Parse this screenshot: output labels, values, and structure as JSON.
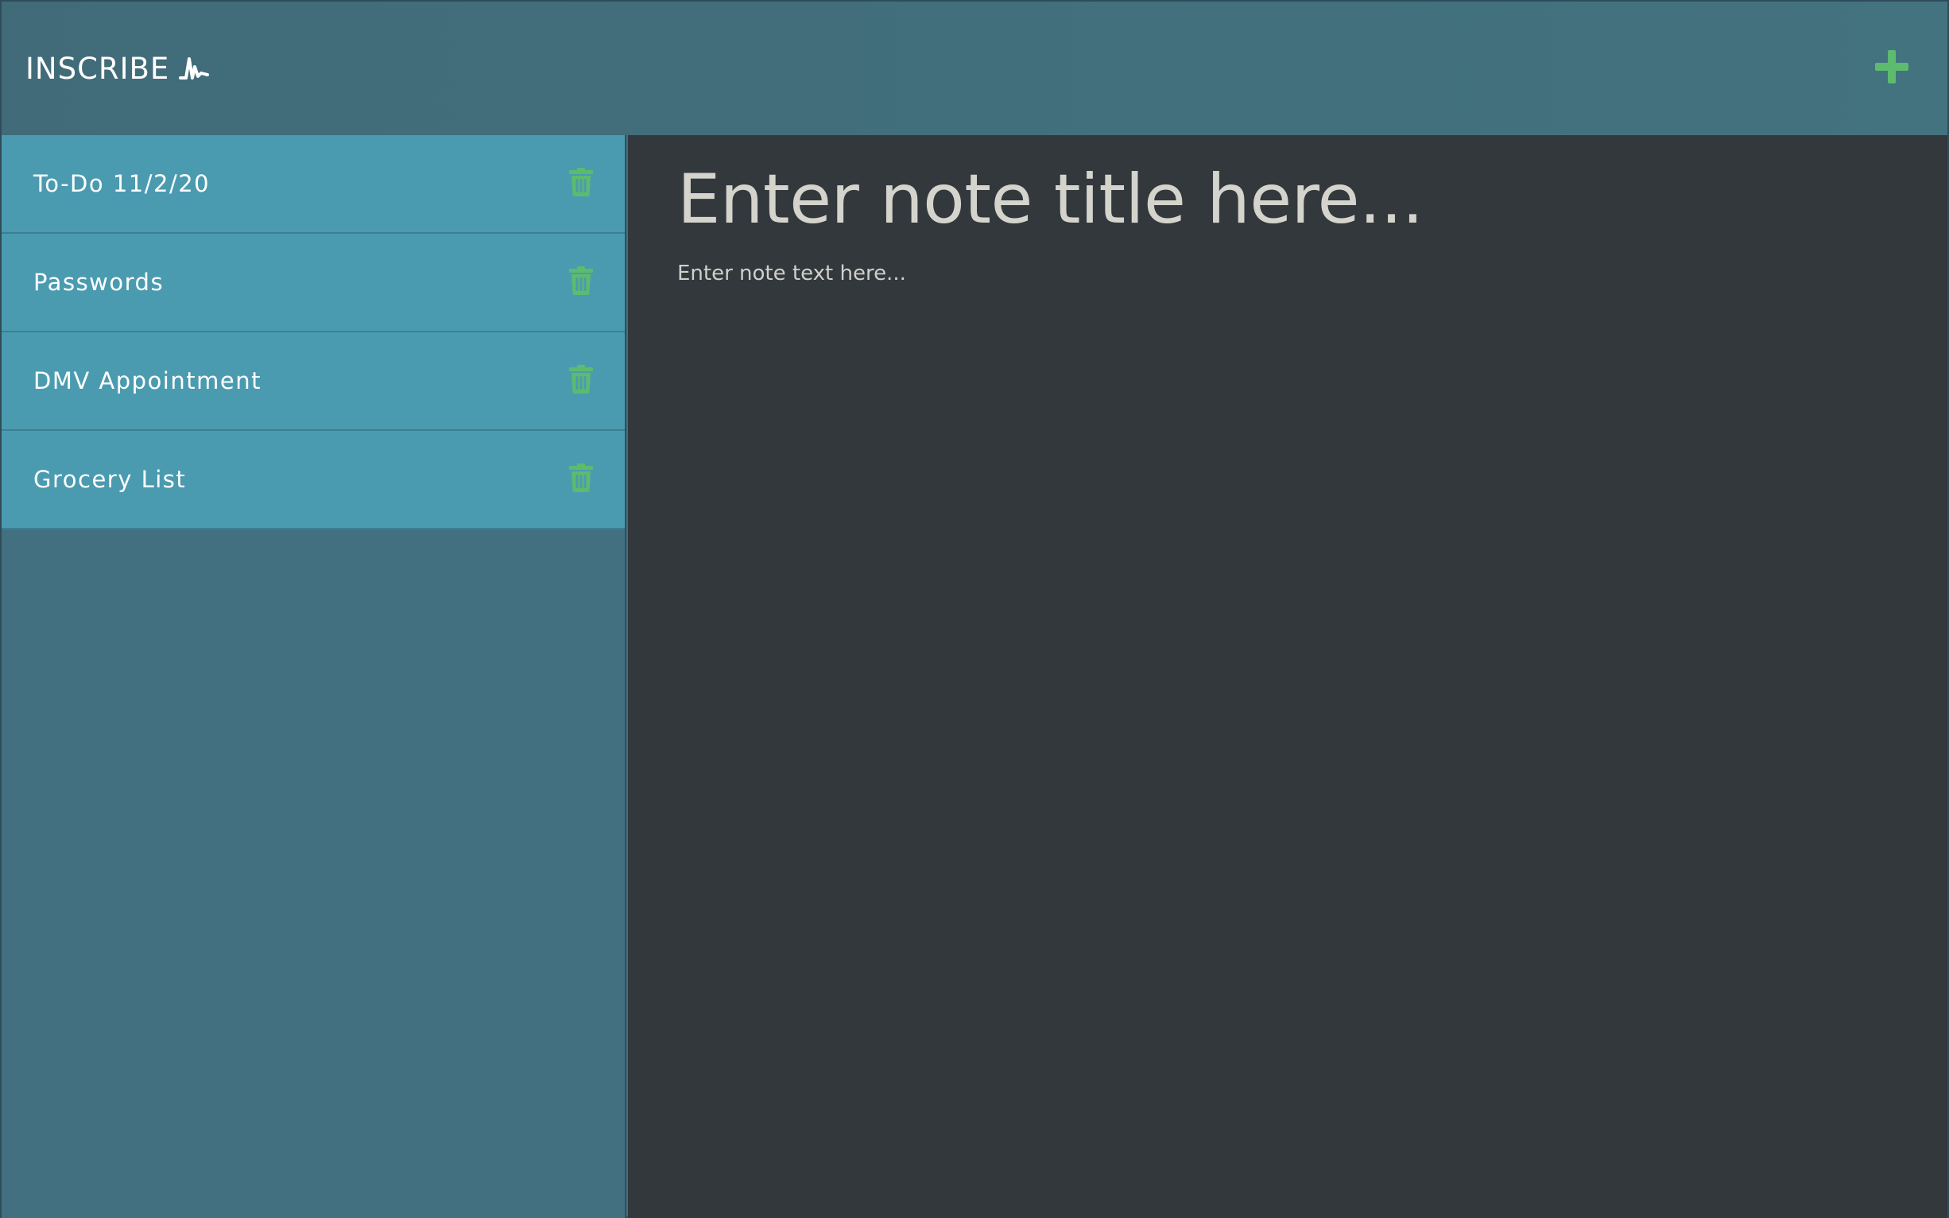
{
  "header": {
    "brand_name": "INSCRIBE",
    "brand_icon": "signature-icon",
    "add_icon": "plus-icon"
  },
  "sidebar": {
    "notes": [
      {
        "title": "To-Do 11/2/20",
        "delete_icon": "trash-icon"
      },
      {
        "title": "Passwords",
        "delete_icon": "trash-icon"
      },
      {
        "title": "DMV Appointment",
        "delete_icon": "trash-icon"
      },
      {
        "title": "Grocery List",
        "delete_icon": "trash-icon"
      }
    ]
  },
  "editor": {
    "title_value": "",
    "title_placeholder": "Enter note title here...",
    "text_value": "",
    "text_placeholder": "Enter note text here..."
  },
  "colors": {
    "header_bg": "#437080",
    "note_item_bg": "#4b9bb0",
    "editor_bg": "#33383d",
    "accent_green": "#5cbb6e",
    "text_light": "#ffffff",
    "placeholder_text": "#d4d4cd"
  }
}
